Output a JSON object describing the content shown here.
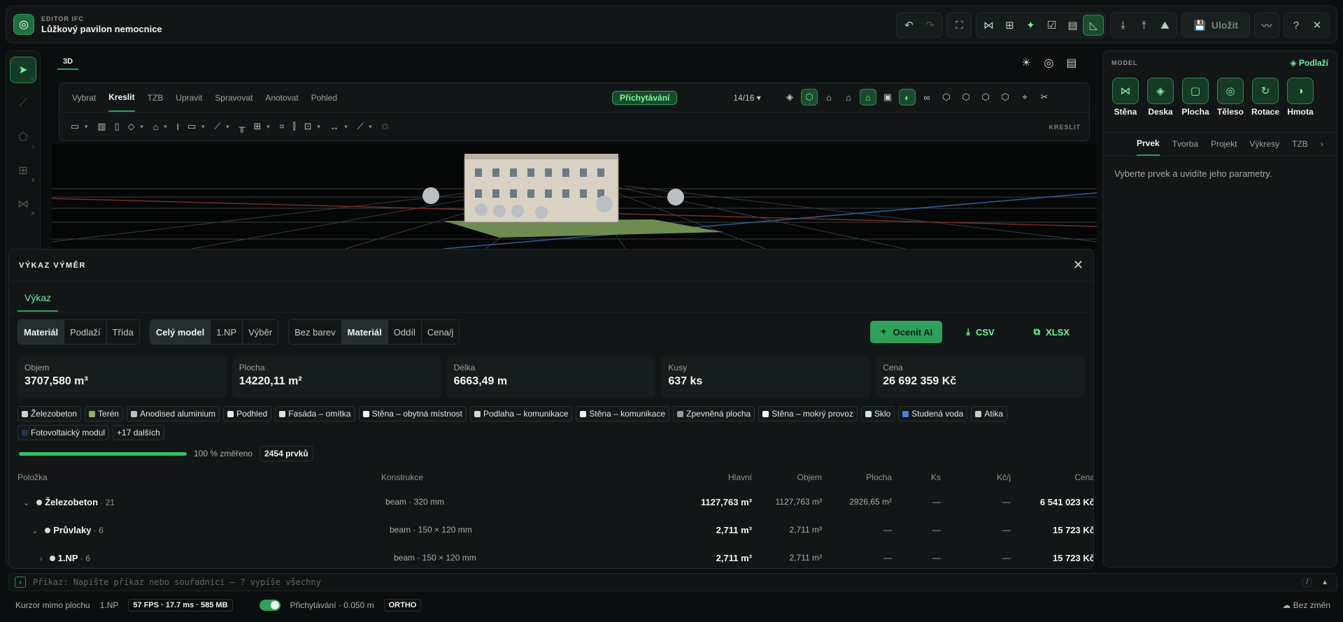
{
  "header": {
    "sub": "EDITOR IFC",
    "title": "Lůžkový pavilon nemocnice",
    "save": "Uložit"
  },
  "viewport": {
    "tab": "3D"
  },
  "toolbar": {
    "tabs": [
      "Vybrat",
      "Kreslit",
      "TZB",
      "Upravit",
      "Spravovat",
      "Anotovat",
      "Pohled"
    ],
    "active_tab": "Kreslit",
    "snap_label": "Přichytávání",
    "snap_count": "14/16 ▾",
    "section": "KRESLIT"
  },
  "right_panel": {
    "title": "MODEL",
    "levels": "Podlaží",
    "tools": [
      "Stěna",
      "Deska",
      "Plocha",
      "Těleso",
      "Rotace",
      "Hmota"
    ],
    "tabs": [
      "Prvek",
      "Tvorba",
      "Projekt",
      "Výkresy",
      "TZB"
    ],
    "message": "Vyberte prvek a uvidíte jeho parametry."
  },
  "quantities": {
    "title": "VÝKAZ VÝMĚR",
    "tab": "Výkaz",
    "group_by": [
      "Materiál",
      "Podlaží",
      "Třída"
    ],
    "scope": [
      "Celý model",
      "1.NP",
      "Výběr"
    ],
    "colors": [
      "Bez barev",
      "Materiál",
      "Oddíl",
      "Cena/j"
    ],
    "ai": "Ocenit AI",
    "csv": "CSV",
    "xlsx": "XLSX",
    "cards": [
      {
        "k": "Objem",
        "v": "3707,580 m³"
      },
      {
        "k": "Plocha",
        "v": "14220,11 m²"
      },
      {
        "k": "Délka",
        "v": "6663,49 m"
      },
      {
        "k": "Kusy",
        "v": "637 ks"
      },
      {
        "k": "Cena",
        "v": "26 692 359 Kč"
      }
    ],
    "chips": [
      {
        "l": "Železobeton",
        "c": "#cfcfcf"
      },
      {
        "l": "Terén",
        "c": "#8fae6b"
      },
      {
        "l": "Anodised aluminium",
        "c": "#bdbdbd"
      },
      {
        "l": "Podhled",
        "c": "#e8e8e8"
      },
      {
        "l": "Fasáda – omítka",
        "c": "#e6e1d6"
      },
      {
        "l": "Stěna – obytná místnost",
        "c": "#f2f2f2"
      },
      {
        "l": "Podlaha – komunikace",
        "c": "#d8d4cc"
      },
      {
        "l": "Stěna – komunikace",
        "c": "#eeeeee"
      },
      {
        "l": "Zpevněná plocha",
        "c": "#9a9a9a"
      },
      {
        "l": "Stěna – mokrý provoz",
        "c": "#f5f5f5"
      },
      {
        "l": "Sklo",
        "c": "#cfe3ee"
      },
      {
        "l": "Studená voda",
        "c": "#3f86d6"
      },
      {
        "l": "Atika",
        "c": "#c9c9c9"
      },
      {
        "l": "Fotovoltaický modul",
        "c": "#1f3550"
      }
    ],
    "more": "+17 dalších",
    "progress": {
      "value": 1.0,
      "label": "100 % změřeno",
      "items": "2454 prvků"
    },
    "columns": [
      "Položka",
      "Konstrukce",
      "Hlavní",
      "Objem",
      "Plocha",
      "Ks",
      "Kč/j",
      "Cena"
    ],
    "rows": [
      {
        "caret": "⌄",
        "name": "Železobeton",
        "count": "· 21",
        "cons": "beam · 320 mm",
        "main": "1127,763 m³",
        "vol": "1127,763 m³",
        "area": "2926,65 m²",
        "ks": "—",
        "kcj": "—",
        "price": "6 541 023 Kč"
      },
      {
        "caret": "⌄",
        "name": "Průvlaky",
        "count": "· 6",
        "cons": "beam · 150 × 120 mm",
        "main": "2,711 m³",
        "vol": "2,711 m³",
        "area": "—",
        "ks": "—",
        "kcj": "—",
        "price": "15 723 Kč"
      },
      {
        "caret": "›",
        "name": "1.NP",
        "count": "· 6",
        "cons": "beam · 150 × 120 mm",
        "main": "2,711 m³",
        "vol": "2,711 m³",
        "area": "—",
        "ks": "—",
        "kcj": "—",
        "price": "15 723 Kč"
      }
    ]
  },
  "command": {
    "placeholder": "Příkaz: Napište příkaz nebo souřadnici — ? vypíše všechny",
    "key": "/"
  },
  "status": {
    "cursor": "Kurzor mimo plochu",
    "level": "1.NP",
    "perf": "57 FPS · 17.7 ms · 585 MB",
    "snap": "Přichytávání · 0.050 m",
    "ortho": "ORTHO",
    "saved": "Bez změn"
  }
}
